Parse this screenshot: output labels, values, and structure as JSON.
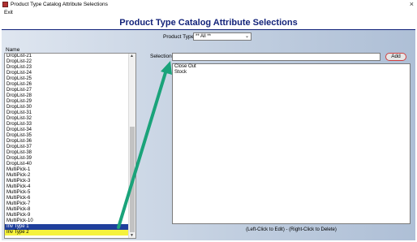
{
  "window": {
    "title": "Product Type Catalog Attribute Selections",
    "close_icon": "×"
  },
  "menu": {
    "exit": "Exit"
  },
  "header": {
    "title": "Product Type Catalog Attribute Selections"
  },
  "product_type": {
    "label": "Product Type:",
    "value": "** All **"
  },
  "name_list": {
    "header": "Name",
    "items": [
      "DropList-21",
      "DropList-22",
      "DropList-23",
      "DropList-24",
      "DropList-25",
      "DropList-26",
      "DropList-27",
      "DropList-28",
      "DropList-29",
      "DropList-30",
      "DropList-31",
      "DropList-32",
      "DropList-33",
      "DropList-34",
      "DropList-35",
      "DropList-36",
      "DropList-37",
      "DropList-38",
      "DropList-39",
      "DropList-40",
      "MultiPick-1",
      "MultiPick-2",
      "MultiPick-3",
      "MultiPick-4",
      "MultiPick-5",
      "MultiPick-6",
      "MultiPick-7",
      "MultiPick-8",
      "MultiPick-9",
      "MultiPick-10",
      "Inv Type 1",
      "Inv Type 2"
    ],
    "selected_index": 30,
    "highlighted_index": 31
  },
  "selection": {
    "label": "Selection:",
    "value": "",
    "add_label": "Add"
  },
  "selection_list": {
    "items": [
      "Close Out",
      "Stock"
    ]
  },
  "footer": {
    "note": "(Left-Click to Edit) - (Right-Click to Delete)"
  },
  "colors": {
    "header_text": "#13237a",
    "selected_row": "#1f3f9c",
    "highlight_row": "#f5f23d",
    "arrow": "#1aa37a"
  }
}
